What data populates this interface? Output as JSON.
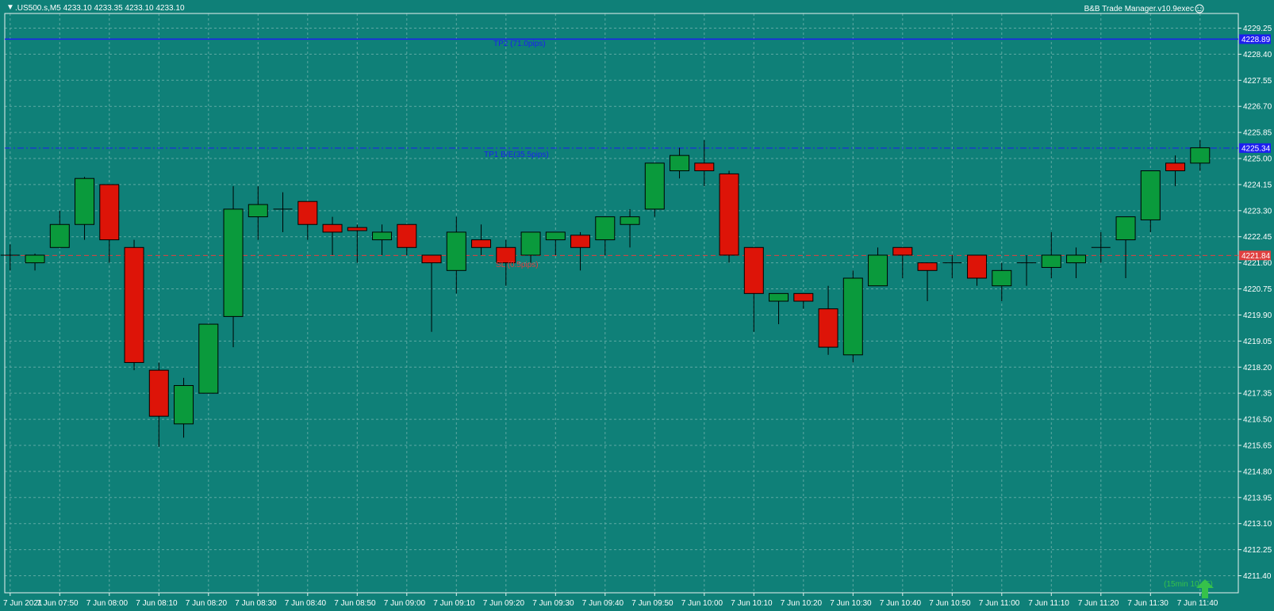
{
  "header": {
    "symbol_info": ".US500.s,M5  4233.10 4233.35 4233.10 4233.10",
    "indicator": "B&B Trade Manager.v10.9exec"
  },
  "colors": {
    "background": "#0f8078",
    "grid": "#5fa9a3",
    "bull": "#0a9a3c",
    "bear": "#dd1408",
    "wick": "#000000",
    "axis_text": "#ffffff",
    "tp_line": "#1e1ef0",
    "sl_line": "#e04040"
  },
  "levels": {
    "tp2": {
      "price": 4228.89,
      "label": "TP2 (71.0pips)",
      "badge": "4228.89"
    },
    "tp1": {
      "price": 4225.34,
      "label": "TP1 B/E(35.5pips)",
      "badge": "4225.34"
    },
    "sl": {
      "price": 4221.84,
      "label": "SL (0.5pips)",
      "badge": "4221.84"
    }
  },
  "timer": {
    "label": "(15min 10:15)"
  },
  "chart_data": {
    "type": "candlestick",
    "symbol": ".US500.s",
    "timeframe": "M5",
    "ylim": [
      4211.4,
      4229.8
    ],
    "y_ticks": [
      "4229.25",
      "4228.40",
      "4227.55",
      "4226.70",
      "4225.85",
      "4225.00",
      "4224.15",
      "4223.30",
      "4222.45",
      "4221.60",
      "4220.75",
      "4219.90",
      "4219.05",
      "4218.20",
      "4217.35",
      "4216.50",
      "4215.65",
      "4214.80",
      "4213.95",
      "4213.10",
      "4212.25",
      "4211.40"
    ],
    "x_labels": [
      {
        "i": 0,
        "label": "7 Jun 2021"
      },
      {
        "i": 2,
        "label": "7 Jun 07:50"
      },
      {
        "i": 4,
        "label": "7 Jun 08:00"
      },
      {
        "i": 6,
        "label": "7 Jun 08:10"
      },
      {
        "i": 8,
        "label": "7 Jun 08:20"
      },
      {
        "i": 10,
        "label": "7 Jun 08:30"
      },
      {
        "i": 12,
        "label": "7 Jun 08:40"
      },
      {
        "i": 14,
        "label": "7 Jun 08:50"
      },
      {
        "i": 16,
        "label": "7 Jun 09:00"
      },
      {
        "i": 18,
        "label": "7 Jun 09:10"
      },
      {
        "i": 20,
        "label": "7 Jun 09:20"
      },
      {
        "i": 22,
        "label": "7 Jun 09:30"
      },
      {
        "i": 24,
        "label": "7 Jun 09:40"
      },
      {
        "i": 26,
        "label": "7 Jun 09:50"
      },
      {
        "i": 28,
        "label": "7 Jun 10:00"
      },
      {
        "i": 30,
        "label": "7 Jun 10:10"
      },
      {
        "i": 32,
        "label": "7 Jun 10:20"
      },
      {
        "i": 34,
        "label": "7 Jun 10:30"
      },
      {
        "i": 36,
        "label": "7 Jun 10:40"
      },
      {
        "i": 38,
        "label": "7 Jun 10:50"
      },
      {
        "i": 40,
        "label": "7 Jun 11:00"
      },
      {
        "i": 42,
        "label": "7 Jun 11:10"
      },
      {
        "i": 44,
        "label": "7 Jun 11:20"
      },
      {
        "i": 46,
        "label": "7 Jun 11:30"
      },
      {
        "i": 48,
        "label": "7 Jun 11:40"
      }
    ],
    "candles": [
      {
        "o": 4221.85,
        "h": 4222.2,
        "l": 4221.35,
        "c": 4221.85
      },
      {
        "o": 4221.6,
        "h": 4221.9,
        "l": 4221.35,
        "c": 4221.85
      },
      {
        "o": 4222.1,
        "h": 4223.3,
        "l": 4222.1,
        "c": 4222.85
      },
      {
        "o": 4222.85,
        "h": 4224.4,
        "l": 4222.35,
        "c": 4224.35
      },
      {
        "o": 4224.15,
        "h": 4224.15,
        "l": 4221.6,
        "c": 4222.35
      },
      {
        "o": 4222.1,
        "h": 4222.35,
        "l": 4218.1,
        "c": 4218.35
      },
      {
        "o": 4218.1,
        "h": 4218.35,
        "l": 4215.6,
        "c": 4216.6
      },
      {
        "o": 4216.35,
        "h": 4217.85,
        "l": 4215.9,
        "c": 4217.6
      },
      {
        "o": 4217.35,
        "h": 4219.6,
        "l": 4217.35,
        "c": 4219.6
      },
      {
        "o": 4219.85,
        "h": 4224.1,
        "l": 4218.85,
        "c": 4223.35
      },
      {
        "o": 4223.1,
        "h": 4224.1,
        "l": 4222.35,
        "c": 4223.5
      },
      {
        "o": 4223.35,
        "h": 4223.9,
        "l": 4222.6,
        "c": 4223.35
      },
      {
        "o": 4223.6,
        "h": 4223.6,
        "l": 4222.35,
        "c": 4222.85
      },
      {
        "o": 4222.85,
        "h": 4223.1,
        "l": 4221.85,
        "c": 4222.6
      },
      {
        "o": 4222.75,
        "h": 4222.85,
        "l": 4221.6,
        "c": 4222.65
      },
      {
        "o": 4222.35,
        "h": 4222.85,
        "l": 4221.85,
        "c": 4222.6
      },
      {
        "o": 4222.85,
        "h": 4222.85,
        "l": 4221.85,
        "c": 4222.1
      },
      {
        "o": 4221.85,
        "h": 4221.85,
        "l": 4219.35,
        "c": 4221.6
      },
      {
        "o": 4221.35,
        "h": 4223.1,
        "l": 4220.6,
        "c": 4222.6
      },
      {
        "o": 4222.35,
        "h": 4222.85,
        "l": 4221.85,
        "c": 4222.1
      },
      {
        "o": 4222.1,
        "h": 4222.35,
        "l": 4220.85,
        "c": 4221.6
      },
      {
        "o": 4221.85,
        "h": 4222.6,
        "l": 4221.6,
        "c": 4222.6
      },
      {
        "o": 4222.35,
        "h": 4222.6,
        "l": 4221.85,
        "c": 4222.6
      },
      {
        "o": 4222.5,
        "h": 4222.6,
        "l": 4221.35,
        "c": 4222.1
      },
      {
        "o": 4222.35,
        "h": 4223.1,
        "l": 4221.85,
        "c": 4223.1
      },
      {
        "o": 4222.85,
        "h": 4223.35,
        "l": 4222.1,
        "c": 4223.1
      },
      {
        "o": 4223.35,
        "h": 4224.85,
        "l": 4223.1,
        "c": 4224.85
      },
      {
        "o": 4224.6,
        "h": 4225.35,
        "l": 4224.35,
        "c": 4225.1
      },
      {
        "o": 4224.85,
        "h": 4225.6,
        "l": 4224.1,
        "c": 4224.6
      },
      {
        "o": 4224.5,
        "h": 4224.6,
        "l": 4221.6,
        "c": 4221.85
      },
      {
        "o": 4222.1,
        "h": 4222.1,
        "l": 4219.35,
        "c": 4220.6
      },
      {
        "o": 4220.35,
        "h": 4220.6,
        "l": 4219.6,
        "c": 4220.6
      },
      {
        "o": 4220.6,
        "h": 4220.6,
        "l": 4220.1,
        "c": 4220.35
      },
      {
        "o": 4220.1,
        "h": 4220.85,
        "l": 4218.6,
        "c": 4218.85
      },
      {
        "o": 4218.6,
        "h": 4221.35,
        "l": 4218.35,
        "c": 4221.1
      },
      {
        "o": 4220.85,
        "h": 4222.1,
        "l": 4220.85,
        "c": 4221.85
      },
      {
        "o": 4222.1,
        "h": 4222.1,
        "l": 4221.1,
        "c": 4221.85
      },
      {
        "o": 4221.6,
        "h": 4221.6,
        "l": 4220.35,
        "c": 4221.35
      },
      {
        "o": 4221.6,
        "h": 4221.85,
        "l": 4221.1,
        "c": 4221.6
      },
      {
        "o": 4221.85,
        "h": 4221.85,
        "l": 4220.85,
        "c": 4221.1
      },
      {
        "o": 4220.85,
        "h": 4221.6,
        "l": 4220.35,
        "c": 4221.35
      },
      {
        "o": 4221.6,
        "h": 4221.85,
        "l": 4220.85,
        "c": 4221.6
      },
      {
        "o": 4221.45,
        "h": 4222.6,
        "l": 4221.1,
        "c": 4221.85
      },
      {
        "o": 4221.6,
        "h": 4222.1,
        "l": 4221.1,
        "c": 4221.85
      },
      {
        "o": 4222.1,
        "h": 4222.6,
        "l": 4221.6,
        "c": 4222.1
      },
      {
        "o": 4222.35,
        "h": 4223.1,
        "l": 4221.1,
        "c": 4223.1
      },
      {
        "o": 4223.0,
        "h": 4224.6,
        "l": 4222.6,
        "c": 4224.6
      },
      {
        "o": 4224.85,
        "h": 4225.1,
        "l": 4224.1,
        "c": 4224.6
      },
      {
        "o": 4224.85,
        "h": 4225.6,
        "l": 4224.6,
        "c": 4225.35
      }
    ]
  }
}
